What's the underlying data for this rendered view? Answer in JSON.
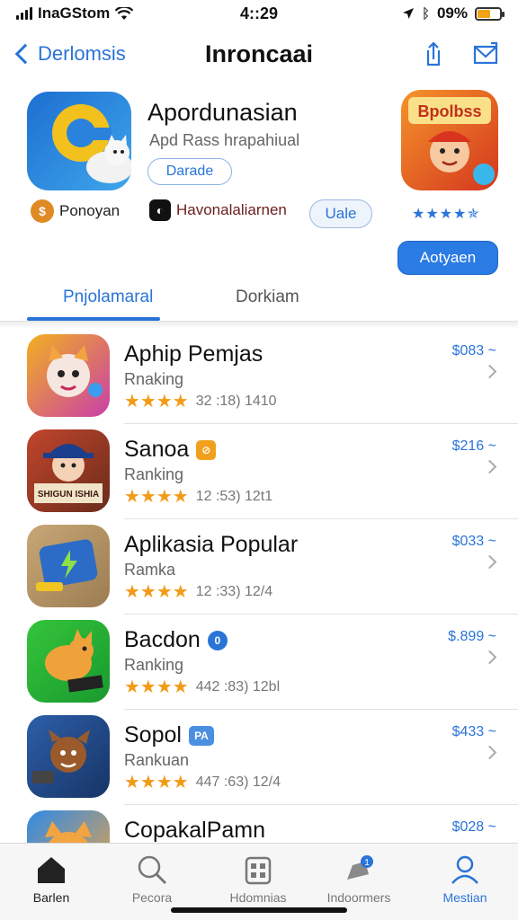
{
  "status_bar": {
    "carrier": "InaGStom",
    "time": "4::29",
    "battery_text": "09%",
    "battery_level": 0.6
  },
  "nav": {
    "back_label": "Derlomsis",
    "title": "Inroncaai",
    "icons": [
      "share-icon",
      "mail-icon"
    ]
  },
  "featured": {
    "title": "Apordunasian",
    "subtitle": "Apd Rass hrapahiual",
    "pill_label": "Darade",
    "meta": [
      {
        "label": "Ponoyan",
        "icon": "coin-icon"
      },
      {
        "label": "Havonalaliarnen",
        "icon": "app-badge-icon"
      }
    ],
    "meta_pill": "Uale",
    "stars_text": "★★★★✯",
    "cta_label": "Aotyaen",
    "right_icon_label": "Bpolbss"
  },
  "tabs": [
    {
      "label": "Pnjolamaral",
      "active": true
    },
    {
      "label": "Dorkiam",
      "active": false
    }
  ],
  "apps": [
    {
      "title": "Aphip Pemjas",
      "sub": "Rnaking",
      "stars": "★★★★",
      "rating": "32 :18) 1410",
      "price": "$083 ~",
      "badge": "",
      "badge_color": "",
      "icon": "cat-mascot-icon"
    },
    {
      "title": "Sanoa",
      "sub": "Ranking",
      "stars": "★★★★",
      "rating": "12 :53) 12t1",
      "price": "$216 ~",
      "badge": "⊘",
      "badge_color": "#f0a01c",
      "icon": "character-hat-icon",
      "icon_text": "SHIGUN ISHIA"
    },
    {
      "title": "Aplikasia Popular",
      "sub": "Ramka",
      "stars": "★★★★",
      "rating": "12 :33) 12/4",
      "price": "$033 ~",
      "badge": "",
      "badge_color": "",
      "icon": "battery-bolt-icon"
    },
    {
      "title": "Bacdon",
      "sub": "Ranking",
      "stars": "★★★★",
      "rating": "442 :83) 12bl",
      "price": "$.899 ~",
      "badge": "0",
      "badge_color": "#2a74d8",
      "icon": "fox-mascot-icon"
    },
    {
      "title": "Sopol",
      "sub": "Rankuan",
      "stars": "★★★★",
      "rating": "447 :63) 12/4",
      "price": "$433 ~",
      "badge": "PA",
      "badge_color": "#4a8fe0",
      "icon": "warrior-icon"
    },
    {
      "title": "CopakalPamn",
      "sub": "",
      "stars": "",
      "rating": "",
      "price": "$028 ~",
      "badge": "",
      "badge_color": "",
      "icon": "cat-partial-icon"
    }
  ],
  "tab_bar": [
    {
      "label": "Barlen",
      "icon": "home-icon",
      "state": "home"
    },
    {
      "label": "Pecora",
      "icon": "search-icon",
      "state": "normal"
    },
    {
      "label": "Hdomnias",
      "icon": "grid-icon",
      "state": "normal"
    },
    {
      "label": "Indoormers",
      "icon": "notification-icon",
      "state": "normal"
    },
    {
      "label": "Mestian",
      "icon": "profile-icon",
      "state": "active"
    }
  ],
  "colors": {
    "accent": "#2a74d8",
    "star": "#f29b18",
    "cta": "#2b7be4"
  }
}
